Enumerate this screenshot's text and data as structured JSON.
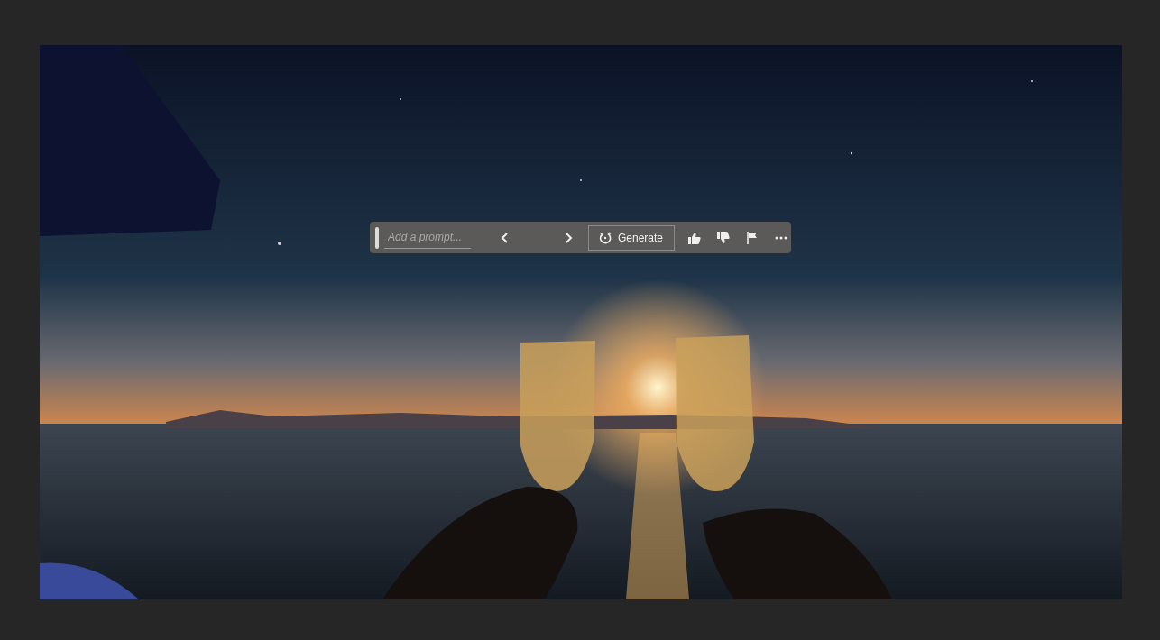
{
  "taskbar": {
    "prompt": {
      "placeholder": "Add a prompt..."
    },
    "generate_button": {
      "label": "Generate"
    }
  }
}
